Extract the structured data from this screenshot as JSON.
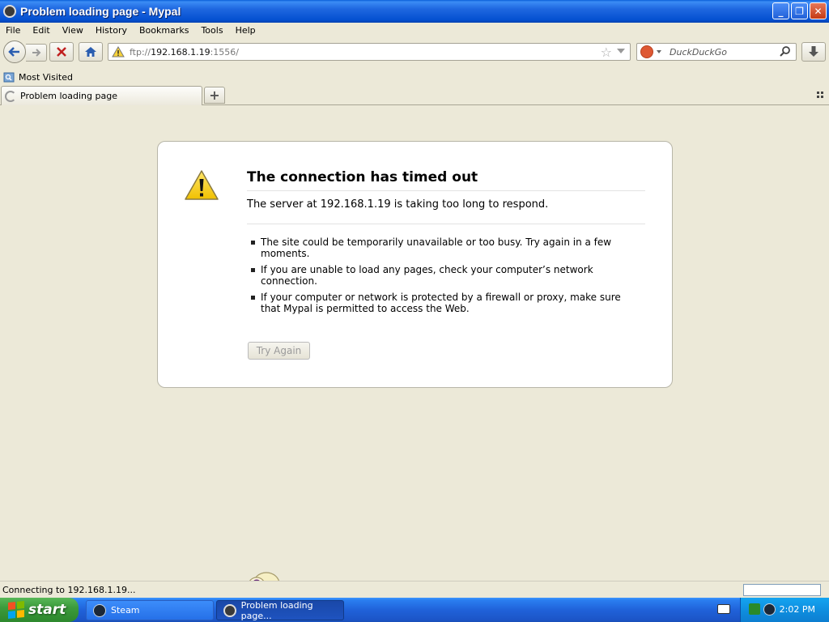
{
  "window": {
    "title": "Problem loading page - Mypal"
  },
  "menubar": {
    "items": [
      "File",
      "Edit",
      "View",
      "History",
      "Bookmarks",
      "Tools",
      "Help"
    ]
  },
  "navbar": {
    "url_scheme": "ftp://",
    "url_host": "192.168.1.19",
    "url_rest": ":1556/",
    "search_placeholder": "DuckDuckGo"
  },
  "bookmarks": {
    "most_visited": "Most Visited"
  },
  "tabs": [
    {
      "label": "Problem loading page"
    }
  ],
  "error": {
    "title": "The connection has timed out",
    "description": "The server at 192.168.1.19 is taking too long to respond.",
    "items": [
      "The site could be temporarily unavailable or too busy. Try again in a few moments.",
      "If you are unable to load any pages, check your computer’s network connection.",
      "If your computer or network is protected by a firewall or proxy, make sure that Mypal is permitted to access the Web."
    ],
    "button": "Try Again"
  },
  "statusbar": {
    "text": "Connecting to 192.168.1.19..."
  },
  "taskbar": {
    "start": "start",
    "tasks": [
      {
        "label": "Steam"
      },
      {
        "label": "Problem loading page..."
      }
    ],
    "clock": "2:02 PM"
  },
  "colors": {
    "titlebar": "#0A5FD8",
    "taskbar": "#2062D9",
    "start": "#3C9B3C",
    "chrome": "#ECE9D8",
    "warning": "#F5D000"
  }
}
